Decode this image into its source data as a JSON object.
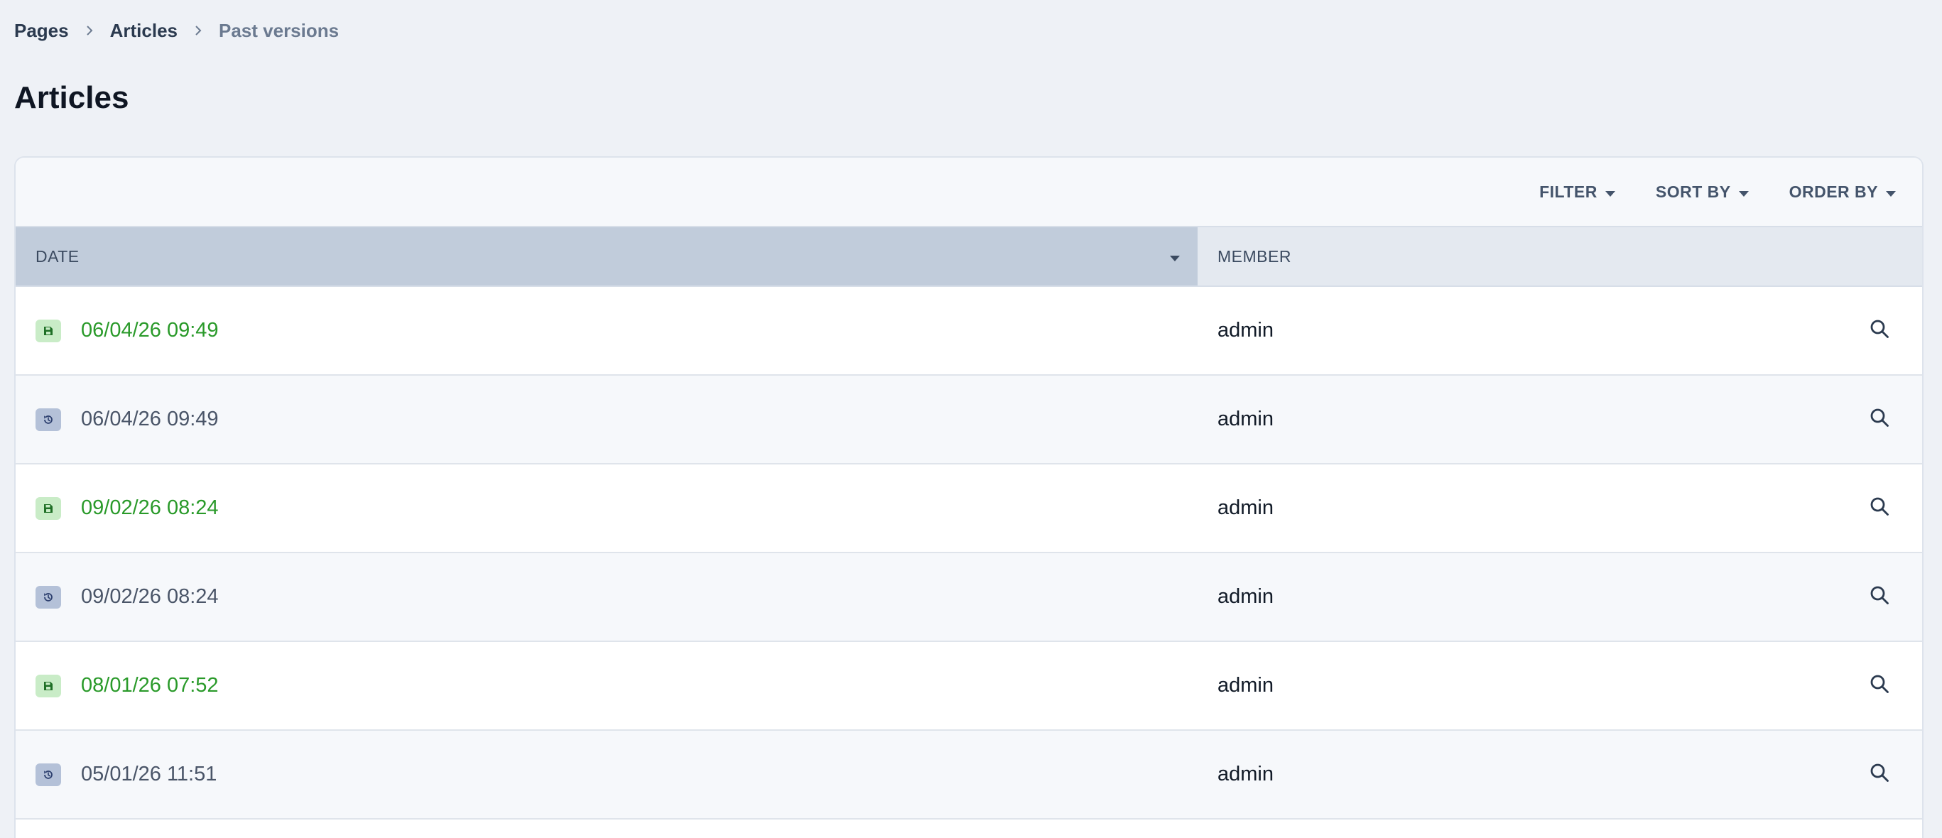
{
  "breadcrumb": {
    "items": [
      "Pages",
      "Articles"
    ],
    "current": "Past versions"
  },
  "page": {
    "title": "Articles"
  },
  "toolbar": {
    "filter_label": "FILTER",
    "sort_label": "SORT BY",
    "order_label": "ORDER BY"
  },
  "table": {
    "columns": [
      "DATE",
      "MEMBER"
    ],
    "rows": [
      {
        "date": "06/04/26 09:49",
        "member": "admin",
        "status": "saved"
      },
      {
        "date": "06/04/26 09:49",
        "member": "admin",
        "status": "history"
      },
      {
        "date": "09/02/26 08:24",
        "member": "admin",
        "status": "saved"
      },
      {
        "date": "09/02/26 08:24",
        "member": "admin",
        "status": "history"
      },
      {
        "date": "08/01/26 07:52",
        "member": "admin",
        "status": "saved"
      },
      {
        "date": "05/01/26 11:51",
        "member": "admin",
        "status": "history"
      }
    ]
  },
  "icons": {
    "breadcrumb_separator": "chevron-right-icon",
    "dropdown": "caret-down-icon",
    "saved": "save-icon",
    "history": "history-icon",
    "view": "search-icon"
  },
  "colors": {
    "saved_text": "#2a9a2a",
    "saved_badge": "#c9ecc7",
    "history_badge": "#b4c1d8",
    "sorted_header": "#c1ccdb"
  }
}
